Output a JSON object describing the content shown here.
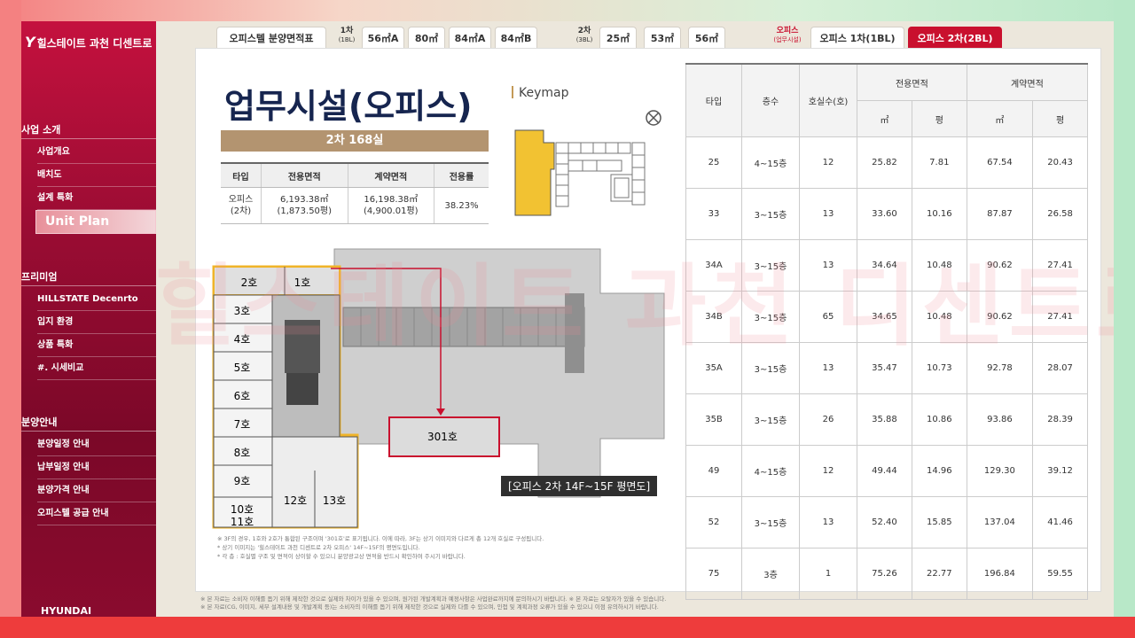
{
  "brand": {
    "logo_text": "힐스테이트 과천 디센트로",
    "footer_logo": "HYUNDAI"
  },
  "sidebar": {
    "sections": [
      {
        "title": "사업 소개",
        "items": [
          "사업개요",
          "배치도",
          "설계 특화",
          "Unit Plan"
        ]
      },
      {
        "title": "프리미엄",
        "items": [
          "HILLSTATE Decenrto",
          "입지 환경",
          "상품 특화",
          "#. 시세비교"
        ]
      },
      {
        "title": "분양안내",
        "items": [
          "분양일정 안내",
          "납부일정 안내",
          "분양가격 안내",
          "오피스텔 공급 안내"
        ]
      }
    ],
    "active": "Unit Plan"
  },
  "tabs": {
    "first": "오피스텔 분양면적표",
    "group1_label": "1차",
    "group1_sub": "(1BL)",
    "group1": [
      "56㎡A",
      "80㎡",
      "84㎡A",
      "84㎡B"
    ],
    "group2_label": "2차",
    "group2_sub": "(3BL)",
    "group2": [
      "25㎡",
      "53㎡",
      "56㎡"
    ],
    "group3_label": "오피스",
    "group3_sub": "(업무시설)",
    "group3": [
      "오피스 1차(1BL)",
      "오피스 2차(2BL)"
    ],
    "active": "오피스 2차(2BL)"
  },
  "content": {
    "title": "업무시설(오피스)",
    "keymap": "Keymap",
    "banner": "2차 168실",
    "summary": {
      "headers": [
        "타입",
        "전용면적",
        "계약면적",
        "전용률"
      ],
      "row": [
        "오피스\n(2차)",
        "6,193.38㎡\n(1,873.50평)",
        "16,198.38㎡\n(4,900.01평)",
        "38.23%"
      ]
    },
    "floorplan": {
      "caption": "[오피스 2차 14F~15F 평면도]",
      "rooms": [
        "2호",
        "1호",
        "3호",
        "4호",
        "5호",
        "6호",
        "7호",
        "8호",
        "9호",
        "10호",
        "11호",
        "12호",
        "13호",
        "301호"
      ]
    },
    "notes": [
      "※ 3F의 경우, 1호와 2호가 통합된 구조이며 '301호'로 표기됩니다.  이에 따라, 3F는 상기 이미지와 다르게 총 12개 호실로 구성됩니다.",
      "* 상기 이미지는 '힐스테이트 과천 디센트로 2차 오피스' 14F~15F의 평면도입니다.",
      "* 각 층 : 호실별 구조 및 면적이 상이할 수 있으니 분양광고상 면적을 반드시 확인하여 주시기 바랍니다."
    ]
  },
  "units_table": {
    "headers": {
      "type": "타입",
      "floors": "층수",
      "rooms": "호실수(호)",
      "exclusive": "전용면적",
      "contract": "계약면적",
      "m2": "㎡",
      "pyeong": "평"
    },
    "rows": [
      [
        "25",
        "4~15층",
        "12",
        "25.82",
        "7.81",
        "67.54",
        "20.43"
      ],
      [
        "33",
        "3~15층",
        "13",
        "33.60",
        "10.16",
        "87.87",
        "26.58"
      ],
      [
        "34A",
        "3~15층",
        "13",
        "34.64",
        "10.48",
        "90.62",
        "27.41"
      ],
      [
        "34B",
        "3~15층",
        "65",
        "34.65",
        "10.48",
        "90.62",
        "27.41"
      ],
      [
        "35A",
        "3~15층",
        "13",
        "35.47",
        "10.73",
        "92.78",
        "28.07"
      ],
      [
        "35B",
        "3~15층",
        "26",
        "35.88",
        "10.86",
        "93.86",
        "28.39"
      ],
      [
        "49",
        "4~15층",
        "12",
        "49.44",
        "14.96",
        "129.30",
        "39.12"
      ],
      [
        "52",
        "3~15층",
        "13",
        "52.40",
        "15.85",
        "137.04",
        "41.46"
      ],
      [
        "75",
        "3층",
        "1",
        "75.26",
        "22.77",
        "196.84",
        "59.55"
      ]
    ]
  },
  "watermark": "힐스테이트 과천 디센트로",
  "footnotes": [
    "※ 본 자료는 소비자 이해를 돕기 위해 제작한 것으로 실제와 차이가 있을 수 있으며, 원가된 개발계획과 예정사항은 사업완료까지에 문의하시기 바랍니다.  ※ 본 자료는 오탈자가 있을 수 있습니다.",
    "※ 본 자료(CG, 이미지, 세부 설계내용 및 개발계획 등)는 소비자의 이해를 돕기 위해 제작한 것으로 실제와 다를 수 있으며, 인접 및 계획과정 오류가 있을 수 있으니 이점 유의하시기 바랍니다."
  ],
  "colors": {
    "brand_red": "#c9102e",
    "title_navy": "#16254f",
    "banner_tan": "#b39470",
    "keymap_yellow": "#f2c232"
  }
}
